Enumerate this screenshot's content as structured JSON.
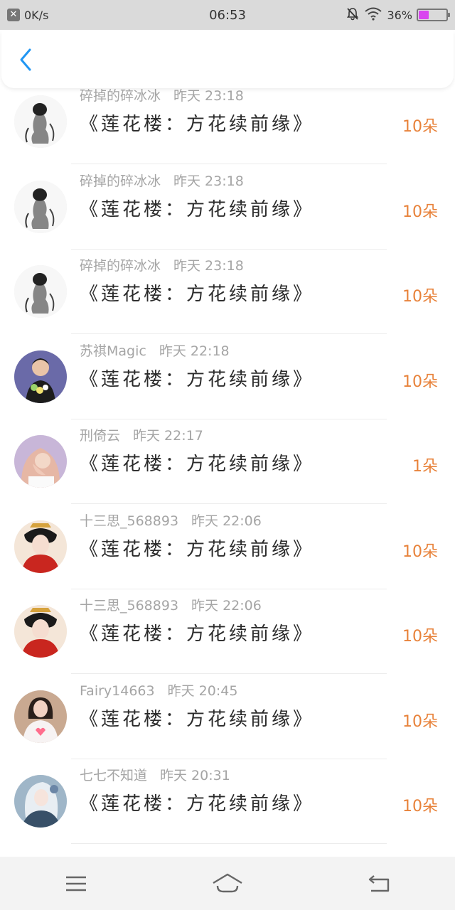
{
  "status_bar": {
    "network_speed": "0K/s",
    "time": "06:53",
    "battery_percent": "36%",
    "battery_level": 0.36,
    "icons": [
      "close-badge-icon",
      "mute-bell-icon",
      "wifi-icon",
      "battery-icon"
    ]
  },
  "header": {
    "back_icon": "chevron-left-icon"
  },
  "colors": {
    "accent": "#e8823a",
    "back": "#2196f3",
    "meta": "#a5a5a5",
    "title": "#2b2b2b"
  },
  "gifts": [
    {
      "user": "碎掉的碎冰冰",
      "time": "昨天 23:18",
      "title": "《莲花楼：方花续前缘》",
      "count": "10朵",
      "avatar": "ink-figure"
    },
    {
      "user": "碎掉的碎冰冰",
      "time": "昨天 23:18",
      "title": "《莲花楼：方花续前缘》",
      "count": "10朵",
      "avatar": "ink-figure"
    },
    {
      "user": "碎掉的碎冰冰",
      "time": "昨天 23:18",
      "title": "《莲花楼：方花续前缘》",
      "count": "10朵",
      "avatar": "ink-figure"
    },
    {
      "user": "苏祺Magic",
      "time": "昨天 22:18",
      "title": "《莲花楼：方花续前缘》",
      "count": "10朵",
      "avatar": "boy-flowers"
    },
    {
      "user": "刑倚云",
      "time": "昨天 22:17",
      "title": "《莲花楼：方花续前缘》",
      "count": "1朵",
      "avatar": "girl-hood"
    },
    {
      "user": "十三思_568893",
      "time": "昨天 22:06",
      "title": "《莲花楼：方花续前缘》",
      "count": "10朵",
      "avatar": "red-costume"
    },
    {
      "user": "十三思_568893",
      "time": "昨天 22:06",
      "title": "《莲花楼：方花续前缘》",
      "count": "10朵",
      "avatar": "red-costume"
    },
    {
      "user": "Fairy14663",
      "time": "昨天 20:45",
      "title": "《莲花楼：方花续前缘》",
      "count": "10朵",
      "avatar": "girl-pink"
    },
    {
      "user": "七七不知道",
      "time": "昨天 20:31",
      "title": "《莲花楼：方花续前缘》",
      "count": "10朵",
      "avatar": "anime-white"
    }
  ],
  "nav": {
    "items": [
      "menu-icon",
      "home-icon",
      "back-icon"
    ]
  }
}
